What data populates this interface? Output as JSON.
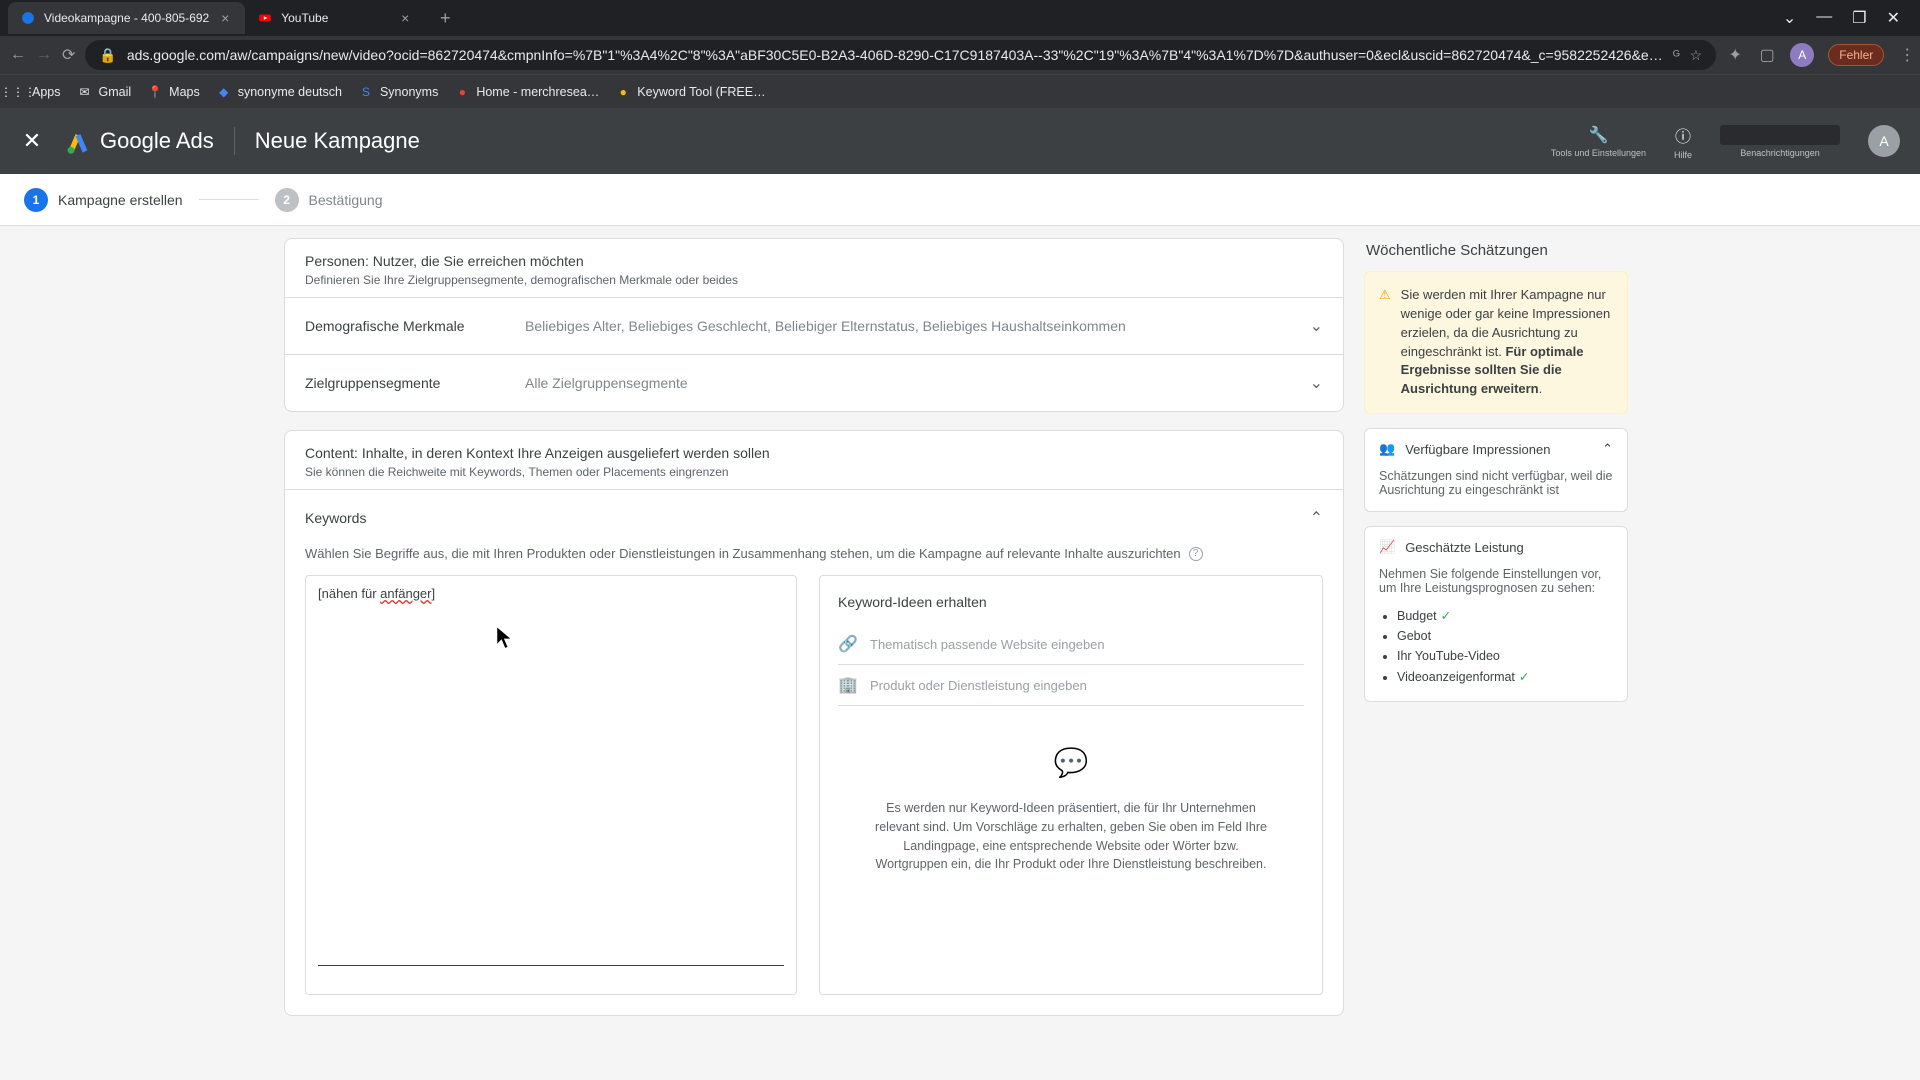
{
  "browser": {
    "tabs": [
      {
        "title": "Videokampagne - 400-805-692",
        "favicon_color": "#1a73e8"
      },
      {
        "title": "YouTube",
        "favicon_color": "#ff0000"
      }
    ],
    "url": "ads.google.com/aw/campaigns/new/video?ocid=862720474&cmpnInfo=%7B\"1\"%3A4%2C\"8\"%3A\"aBF30C5E0-B2A3-406D-8290-C17C9187403A--33\"%2C\"19\"%3A%7B\"4\"%3A1%7D%7D&authuser=0&ecl&uscid=862720474&_c=9582252426&e…",
    "error_label": "Fehler",
    "bookmarks": [
      {
        "name": "Apps"
      },
      {
        "name": "Gmail"
      },
      {
        "name": "Maps"
      },
      {
        "name": "synonyme deutsch"
      },
      {
        "name": "Synonyms"
      },
      {
        "name": "Home - merchresea…"
      },
      {
        "name": "Keyword Tool (FREE…"
      }
    ],
    "avatar_letter": "A"
  },
  "header": {
    "product": "Google Ads",
    "page_title": "Neue Kampagne",
    "tools_label": "Tools und Einstellungen",
    "help_label": "Hilfe",
    "notif_label": "Benachrichtigungen",
    "avatar_letter": "A"
  },
  "stepper": {
    "step1": "Kampagne erstellen",
    "step2": "Bestätigung"
  },
  "personen": {
    "title_strong": "Personen",
    "title_rest": ": Nutzer, die Sie erreichen möchten",
    "sub_pre": "Definieren Sie Ihre ",
    "sub_b1": "Zielgruppensegmente",
    "sub_mid": ", ",
    "sub_b2": "demografischen Merkmale",
    "sub_post": " oder beides",
    "demo_label": "Demografische Merkmale",
    "demo_val": "Beliebiges Alter, Beliebiges Geschlecht, Beliebiger Elternstatus, Beliebiges Haushaltseinkommen",
    "seg_label": "Zielgruppensegmente",
    "seg_val": "Alle Zielgruppensegmente"
  },
  "content_card": {
    "title_strong": "Content",
    "title_rest": ": Inhalte, in deren Kontext Ihre Anzeigen ausgeliefert werden sollen",
    "sub_pre": "Sie können die Reichweite mit ",
    "sub_b1": "Keywords",
    "sub_mid1": ", ",
    "sub_b2": "Themen",
    "sub_mid2": " oder ",
    "sub_b3": "Placements",
    "sub_post": " eingrenzen",
    "keywords_title": "Keywords",
    "keywords_hint": "Wählen Sie Begriffe aus, die mit Ihren Produkten oder Dienstleistungen in Zusammenhang stehen, um die Kampagne auf relevante Inhalte auszurichten",
    "textarea_prefix": "[nähen für ",
    "textarea_err": "anfänger",
    "textarea_suffix": "]",
    "ideas_title": "Keyword-Ideen erhalten",
    "ideas_website_ph": "Thematisch passende Website eingeben",
    "ideas_product_ph": "Produkt oder Dienstleistung eingeben",
    "ideas_empty": "Es werden nur Keyword-Ideen präsentiert, die für Ihr Unternehmen relevant sind. Um Vorschläge zu erhalten, geben Sie oben im Feld Ihre Landingpage, eine entsprechende Website oder Wörter bzw. Wortgruppen ein, die Ihr Produkt oder Ihre Dienstleistung beschreiben."
  },
  "sidebar": {
    "title": "Wöchentliche Schätzungen",
    "warn_pre": "Sie werden mit Ihrer Kampagne nur wenige oder gar keine Impressionen erzielen, da die Ausrichtung zu eingeschränkt ist. ",
    "warn_bold": "Für optimale Ergebnisse sollten Sie die Ausrichtung erweitern",
    "warn_post": ".",
    "impressions_title": "Verfügbare Impressionen",
    "impressions_body": "Schätzungen sind nicht verfügbar, weil die Ausrichtung zu eingeschränkt ist",
    "leistung_title": "Geschätzte Leistung",
    "leistung_intro": "Nehmen Sie folgende Einstellungen vor, um Ihre Leistungsprognosen zu sehen:",
    "leistung_items": [
      "Budget",
      "Gebot",
      "Ihr YouTube-Video",
      "Videoanzeigenformat"
    ],
    "leistung_checks": [
      true,
      false,
      false,
      true
    ]
  }
}
